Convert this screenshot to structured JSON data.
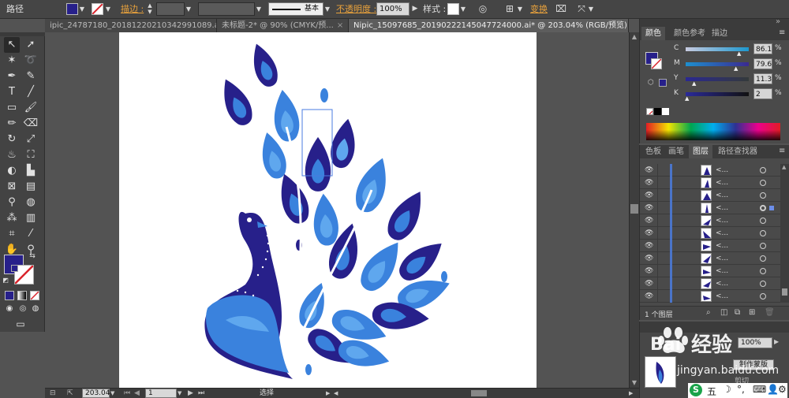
{
  "control_bar": {
    "mode_label": "路径",
    "stroke_label": "描边 :",
    "stroke_style": "基本",
    "opacity_label": "不透明度 :",
    "opacity_value": "100%",
    "style_label": "样式 :",
    "transform_label": "变换",
    "colors": {
      "fill": "#27208a",
      "stroke_none": "#d9232b"
    }
  },
  "tabs": [
    {
      "label": "ipic_24787180_20181220210342991089.ai*",
      "close": "×"
    },
    {
      "label": "未标题-2* @ 90% (CMYK/预...",
      "close": "×"
    },
    {
      "label": "Nipic_15097685_20190222145047724000.ai* @ 203.04% (RGB/预览)",
      "close": "×"
    }
  ],
  "status_bar": {
    "zoom": "203.04",
    "page": "1",
    "tool_status": "选择"
  },
  "color_panel": {
    "tabs": [
      "颜色",
      "颜色参考",
      "描边"
    ],
    "channels": [
      {
        "name": "C",
        "value": "86.19",
        "unit": "%"
      },
      {
        "name": "M",
        "value": "79.64",
        "unit": "%"
      },
      {
        "name": "Y",
        "value": "11.38",
        "unit": "%"
      },
      {
        "name": "K",
        "value": "2",
        "unit": "%"
      }
    ]
  },
  "layers_panel": {
    "tabs": [
      "色板",
      "画笔",
      "图层",
      "路径查找器"
    ],
    "row_label": "<...",
    "count_label": "1 个图层",
    "rows": 11
  },
  "lower_panel": {
    "opacity_value": "100%",
    "make_mask": "制作蒙版",
    "clip_label": "剪切"
  },
  "watermark": {
    "text": "经验",
    "url": "jingyan.baidu.com",
    "brand": "Bai"
  },
  "peacock_colors": {
    "dark": "#27208a",
    "mid": "#3a82dd",
    "light": "#5fa7ee"
  }
}
